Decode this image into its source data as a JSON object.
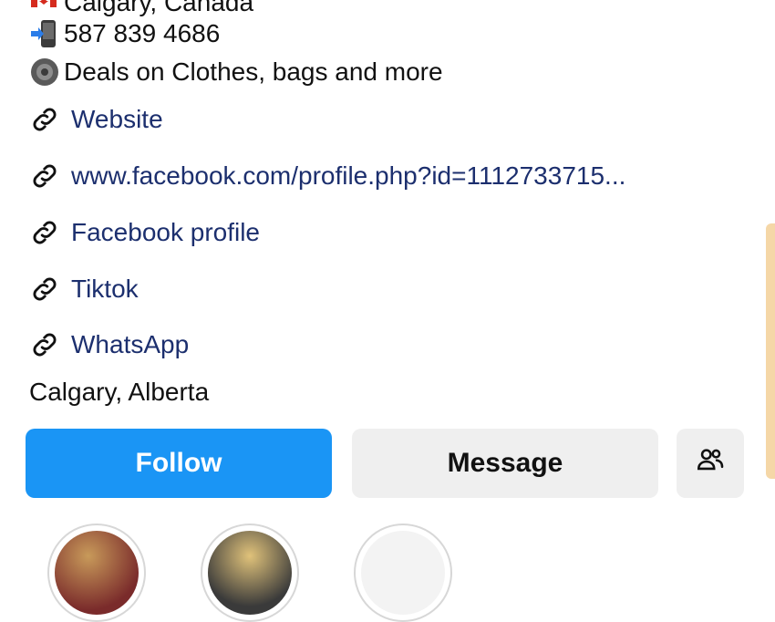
{
  "contact": {
    "location_top": "Calgary, Canada",
    "phone": "587 839 4686",
    "tagline": "Deals on Clothes, bags and more"
  },
  "links": [
    {
      "label": "Website"
    },
    {
      "label": "www.facebook.com/profile.php?id=1112733715..."
    },
    {
      "label": "Facebook profile"
    },
    {
      "label": "Tiktok"
    },
    {
      "label": "WhatsApp"
    }
  ],
  "address": "Calgary, Alberta",
  "actions": {
    "follow_label": "Follow",
    "message_label": "Message"
  },
  "icons": {
    "location": "flag-icon",
    "phone": "mobile-phone-icon",
    "tagline": "speaker-icon",
    "link": "link-icon",
    "people": "people-icon"
  },
  "colors": {
    "follow_bg": "#1a95f5",
    "link_text": "#1c2f6e",
    "button_gray": "#efefef"
  }
}
